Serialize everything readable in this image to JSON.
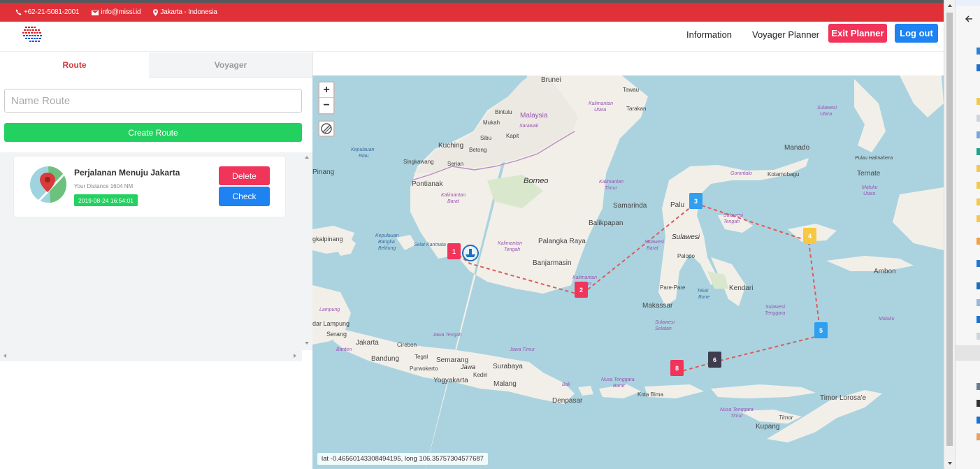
{
  "topbar": {
    "phone": "+62-21-5081-2001",
    "email": "info@missi.id",
    "location": "Jakarta - Indonesia"
  },
  "nav": {
    "information": "Information",
    "voyager_planner": "Voyager Planner",
    "exit_planner": "Exit Planner",
    "logout": "Log out"
  },
  "tabs": {
    "route": "Route",
    "voyager": "Voyager"
  },
  "form": {
    "name_placeholder": "Name Route",
    "create_button": "Create Route"
  },
  "routes": [
    {
      "title": "Perjalanan Menuju Jakarta",
      "distance": "Your Distance 1604 NM",
      "date": "2019-08-24 16:54:01",
      "delete": "Delete",
      "check": "Check"
    }
  ],
  "map": {
    "coords": "lat -0.46560143308494195, long 106.35757304577687",
    "zoom_in": "+",
    "zoom_out": "−",
    "waypoints": [
      {
        "num": "1",
        "color": "#f0345a"
      },
      {
        "num": "2",
        "color": "#f0345a"
      },
      {
        "num": "3",
        "color": "#2f9ff0"
      },
      {
        "num": "4",
        "color": "#f7c940"
      },
      {
        "num": "5",
        "color": "#2f9ff0"
      },
      {
        "num": "6",
        "color": "#3d3d4d"
      },
      {
        "num": "8",
        "color": "#f0345a"
      }
    ],
    "labels": {
      "brunei": "Brunei",
      "tawau": "Tawau",
      "malaysia": "Malaysia",
      "bintulu": "Bintulu",
      "mukah": "Mukah",
      "sarawak": "Sarawak",
      "kaltara1": "Kalimantan",
      "kaltara2": "Utara",
      "tarakan": "Tarakan",
      "sibu": "Sibu",
      "kapit": "Kapit",
      "kuching": "Kuching",
      "betong": "Betong",
      "kepri1": "Kepulauan",
      "kepri2": "Riau",
      "singkawang": "Singkawang",
      "serian": "Serian",
      "pinang": "Pinang",
      "pontianak": "Pontianak",
      "kalbar1": "Kalimantan",
      "kalbar2": "Barat",
      "borneo": "Borneo",
      "kaltim1": "Kalimantan",
      "kaltim2": "Timur",
      "samarinda": "Samarinda",
      "balikpapan": "Balikpapan",
      "palangka": "Palangka Raya",
      "kalteng1": "Kalimantan",
      "kalteng2": "Tengah",
      "banjarmasin": "Banjarmasin",
      "kalsel1": "Kalimantan",
      "kalsel2": "Selatan",
      "pangkalpinang": "gkalpinang",
      "babel1": "Kepulauan",
      "babel2": "Bangka",
      "babel3": "Belitung",
      "selatkarimata": "Selat Karimata",
      "manado": "Manado",
      "sulut1": "Sulawesi",
      "sulut2": "Utara",
      "gorontalo": "Gorontalo",
      "kotamobagu": "Kotamobagu",
      "halmahera": "Pulau Halmahera",
      "ternate": "Ternate",
      "malut1": "Maluku",
      "malut2": "Utara",
      "palu": "Palu",
      "sulteng1": "Sulawesi",
      "sulteng2": "Tengah",
      "sulbar1": "Sulawesi",
      "sulbar2": "Barat",
      "sulawesi": "Sulawesi",
      "palopo": "Palopo",
      "parepare": "Pare-Pare",
      "telukbone1": "Teluk",
      "telukbone2": "Bone",
      "kendari": "Kendari",
      "makassar": "Makassar",
      "sultra1": "Sulawesi",
      "sultra2": "Tenggara",
      "sulsel1": "Sulawesi",
      "sulsel2": "Selatan",
      "ambon": "Ambon",
      "maluku": "Maluku",
      "lampungprov": "Lampung",
      "bandarlampung": "dar Lampung",
      "serang": "Serang",
      "jakarta": "Jakarta",
      "cirebon": "Cirebon",
      "banten": "Banten",
      "bandung": "Bandung",
      "tegal": "Tegal",
      "semarang": "Semarang",
      "jateng": "Jawa Tengah",
      "purwokerto": "Purwokerto",
      "jawa": "Jawa",
      "jatim": "Jawa Timur",
      "surabaya": "Surabaya",
      "kediri": "Kediri",
      "yogyakarta": "Yogyakarta",
      "malang": "Malang",
      "bali": "Bali",
      "denpasar": "Denpasar",
      "ntb1": "Nusa Tenggara",
      "ntb2": "Barat",
      "kotabima": "Kota Bima",
      "ntt1": "Nusa Tenggara",
      "ntt2": "Timur",
      "timor": "Timor",
      "kupang": "Kupang",
      "timorleste": "Timor Lorosa'e"
    }
  }
}
